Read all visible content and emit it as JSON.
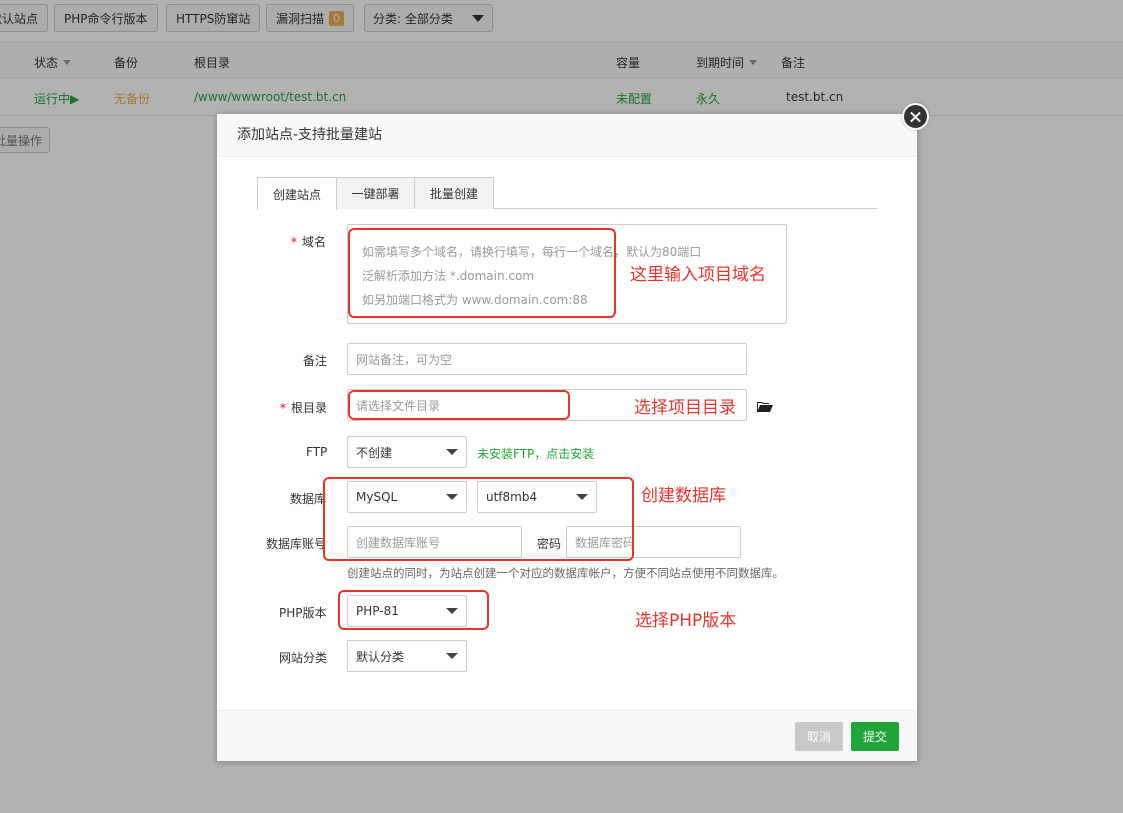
{
  "toolbar": {
    "default_site": "默认站点",
    "php_cli": "PHP命令行版本",
    "https_firewall": "HTTPS防窜站",
    "vuln_scan": "漏洞扫描",
    "vuln_count": "0",
    "category_select": "分类: 全部分类"
  },
  "table": {
    "headers": {
      "status": "状态",
      "backup": "备份",
      "root": "根目录",
      "quota": "容量",
      "expire": "到期时间",
      "note": "备注"
    },
    "row": {
      "status": "运行中▶",
      "backup": "无备份",
      "root": "/www/wwwroot/test.bt.cn",
      "quota": "未配置",
      "expire": "永久",
      "note": "test.bt.cn"
    },
    "batch_button": "批量操作"
  },
  "modal": {
    "title": "添加站点-支持批量建站",
    "tabs": [
      "创建站点",
      "一键部署",
      "批量创建"
    ],
    "domain": {
      "label": "域名",
      "placeholder_line1": "如需填写多个域名，请换行填写，每行一个域名，默认为80端口",
      "placeholder_line2": "泛解析添加方法 *.domain.com",
      "placeholder_line3": "如另加端口格式为 www.domain.com:88"
    },
    "note": {
      "label": "备注",
      "placeholder": "网站备注，可为空"
    },
    "root": {
      "label": "根目录",
      "placeholder": "请选择文件目录"
    },
    "ftp": {
      "label": "FTP",
      "value": "不创建",
      "hint": "未安装FTP，点击安装"
    },
    "database": {
      "label": "数据库",
      "type": "MySQL",
      "charset": "utf8mb4"
    },
    "db_account": {
      "label": "数据库账号",
      "account_placeholder": "创建数据库账号",
      "password_label": "密码",
      "password_placeholder": "数据库密码",
      "hint": "创建站点的同时，为站点创建一个对应的数据库帐户，方便不同站点使用不同数据库。"
    },
    "php": {
      "label": "PHP版本",
      "value": "PHP-81"
    },
    "category": {
      "label": "网站分类",
      "value": "默认分类"
    },
    "cancel": "取消",
    "submit": "提交"
  },
  "annotations": {
    "domain": "这里输入项目域名",
    "root": "选择项目目录",
    "database": "创建数据库",
    "php": "选择PHP版本"
  },
  "colors": {
    "accent_green": "#20a53a",
    "annotation_red": "#e8352c",
    "warning_orange": "#f0ad4e"
  }
}
